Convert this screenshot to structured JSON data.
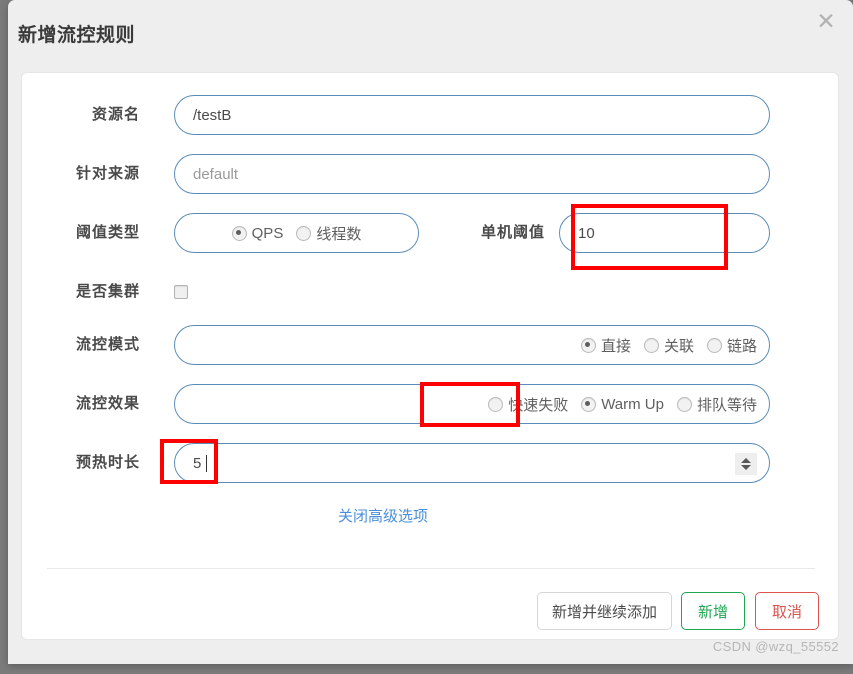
{
  "dialog": {
    "title": "新增流控规则",
    "close_icon": "close-icon"
  },
  "form": {
    "rows": [
      {
        "label": "资源名",
        "value": "/testB",
        "kind": "text"
      },
      {
        "label": "针对来源",
        "value": "default",
        "kind": "text"
      },
      {
        "label": "阈值类型",
        "kind": "radio"
      },
      {
        "label": "是否集群",
        "kind": "checkbox"
      },
      {
        "label": "流控模式",
        "kind": "radio"
      },
      {
        "label": "流控效果",
        "kind": "radio"
      },
      {
        "label": "预热时长",
        "kind": "number"
      }
    ],
    "resource_name": {
      "label": "资源名",
      "value": "/testB"
    },
    "origin": {
      "label": "针对来源",
      "value": "default"
    },
    "threshold_type": {
      "label": "阈值类型",
      "options": [
        "QPS",
        "线程数"
      ],
      "selected": "QPS"
    },
    "single_threshold": {
      "label": "单机阈值",
      "value": "10"
    },
    "cluster": {
      "label": "是否集群",
      "checked": false
    },
    "flow_mode": {
      "label": "流控模式",
      "options": [
        "直接",
        "关联",
        "链路"
      ],
      "selected": "直接"
    },
    "flow_effect": {
      "label": "流控效果",
      "options": [
        "快速失败",
        "Warm Up",
        "排队等待"
      ],
      "selected": "Warm Up"
    },
    "warmup_duration": {
      "label": "预热时长",
      "value": "5",
      "spinner_icon": "spinner-updown-icon"
    },
    "advanced_link": "关闭高级选项"
  },
  "footer": {
    "add_and_continue": "新增并继续添加",
    "add": "新增",
    "cancel": "取消"
  },
  "watermark": "CSDN @wzq_55552",
  "colors": {
    "link": "#4a90d9",
    "add": "#21a453",
    "cancel": "#d9534f",
    "annotation": "#ff0000",
    "field_border": "#5b8cb8"
  }
}
